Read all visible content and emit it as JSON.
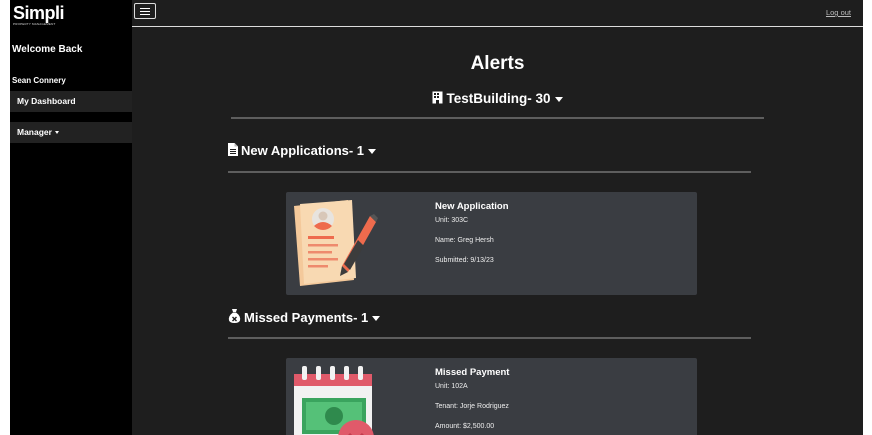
{
  "sidebar": {
    "logo": "Simpli",
    "logo_sub": "PROPERTY MANAGEMENT",
    "welcome": "Welcome Back",
    "user": "Sean Connery",
    "dashboard": "My Dashboard",
    "manager": "Manager"
  },
  "topbar": {
    "logout": "Log out"
  },
  "main": {
    "title": "Alerts",
    "building": "TestBuilding- 30",
    "sections": [
      {
        "heading": "New Applications- 1",
        "card": {
          "title": "New Application",
          "lines": [
            "Unit: 303C",
            "Name: Greg Hersh",
            "Submitted: 9/13/23"
          ]
        }
      },
      {
        "heading": "Missed Payments- 1",
        "card": {
          "title": "Missed Payment",
          "lines": [
            "Unit: 102A",
            "Tenant: Jorje Rodriguez",
            "Amount: $2,500.00"
          ]
        }
      }
    ]
  },
  "icons": {
    "building": "building-icon",
    "document": "file-icon",
    "money_bag": "money-bag-icon",
    "hamburger": "menu-icon"
  },
  "colors": {
    "sidebar_bg": "#000000",
    "main_bg": "#1e1e1e",
    "card_bg": "#3a3d42",
    "accent": "#e8735a"
  }
}
